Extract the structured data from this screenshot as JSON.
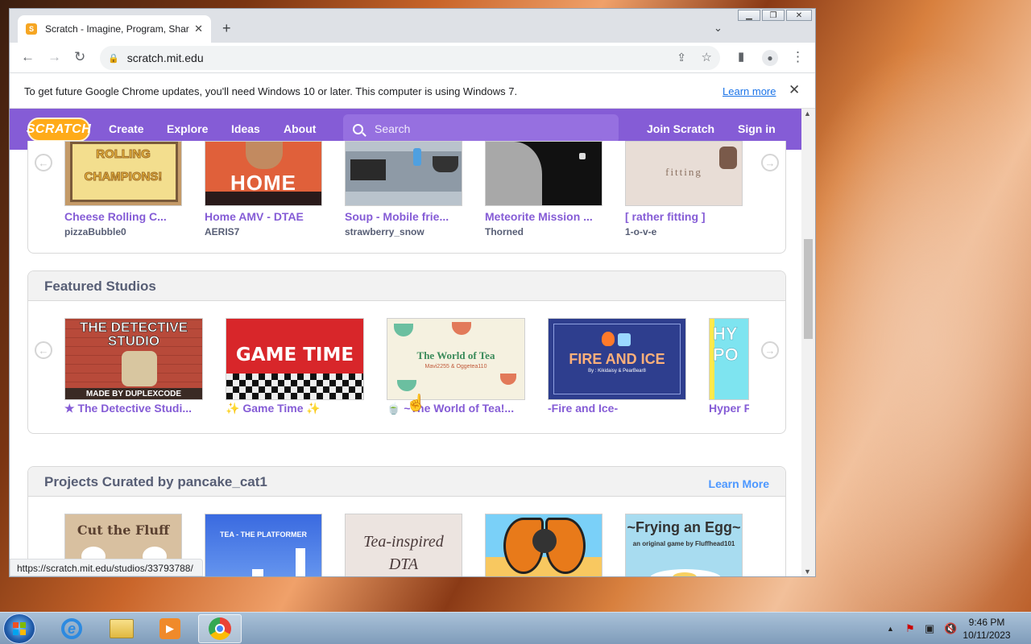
{
  "browser": {
    "tab_title": "Scratch - Imagine, Program, Share",
    "url": "scratch.mit.edu",
    "status_url": "https://scratch.mit.edu/studios/33793788/",
    "info_message": "To get future Google Chrome updates, you'll need Windows 10 or later. This computer is using Windows 7.",
    "info_link": "Learn more"
  },
  "nav": {
    "logo": "SCRATCH",
    "links": [
      "Create",
      "Explore",
      "Ideas",
      "About"
    ],
    "search_placeholder": "Search",
    "join": "Join Scratch",
    "signin": "Sign in"
  },
  "top_projects": [
    {
      "title": "Cheese Rolling C...",
      "author": "pizzaBubble0",
      "thumb_text": "ROLLING CHAMPIONS!"
    },
    {
      "title": "Home AMV - DTAE",
      "author": "AERIS7",
      "thumb_text": "HOME"
    },
    {
      "title": "Soup - Mobile frie...",
      "author": "strawberry_snow",
      "thumb_text": ""
    },
    {
      "title": "Meteorite Mission ...",
      "author": "Thorned",
      "thumb_text": ""
    },
    {
      "title": "[ rather fitting ]",
      "author": "1-o-v-e",
      "thumb_text": "fitting"
    }
  ],
  "featured_studios": {
    "heading": "Featured Studios",
    "items": [
      {
        "title": "★ The Detective Studi...",
        "thumb_text": "THE DETECTIVE STUDIO",
        "thumb_sub": "MADE BY DUPLEXCODE"
      },
      {
        "title": "✨ Game Time ✨",
        "thumb_text": "GAME TIME",
        "thumb_sub": ""
      },
      {
        "title": "🍵 ~The World of Tea!...",
        "thumb_text": "The World of Tea",
        "thumb_sub": "Mavi2255 & Oggetea110"
      },
      {
        "title": "-Fire and Ice-",
        "thumb_text": "FIRE AND ICE",
        "thumb_sub": "By : Kikidaisy & PearBear8"
      },
      {
        "title": "Hyper F",
        "thumb_text": "HY PO",
        "thumb_sub": ""
      }
    ]
  },
  "curated": {
    "heading": "Projects Curated by pancake_cat1",
    "learn_more": "Learn More",
    "items": [
      {
        "thumb_text": "Cut the Fluff"
      },
      {
        "thumb_text": "TEA - THE PLATFORMER"
      },
      {
        "thumb_text": "Tea-inspired DTA"
      },
      {
        "thumb_text": ""
      },
      {
        "thumb_text": "~Frying an Egg~",
        "thumb_sub": "an original game by Fluffhead101"
      }
    ]
  },
  "taskbar": {
    "time": "9:46 PM",
    "date": "10/11/2023"
  }
}
